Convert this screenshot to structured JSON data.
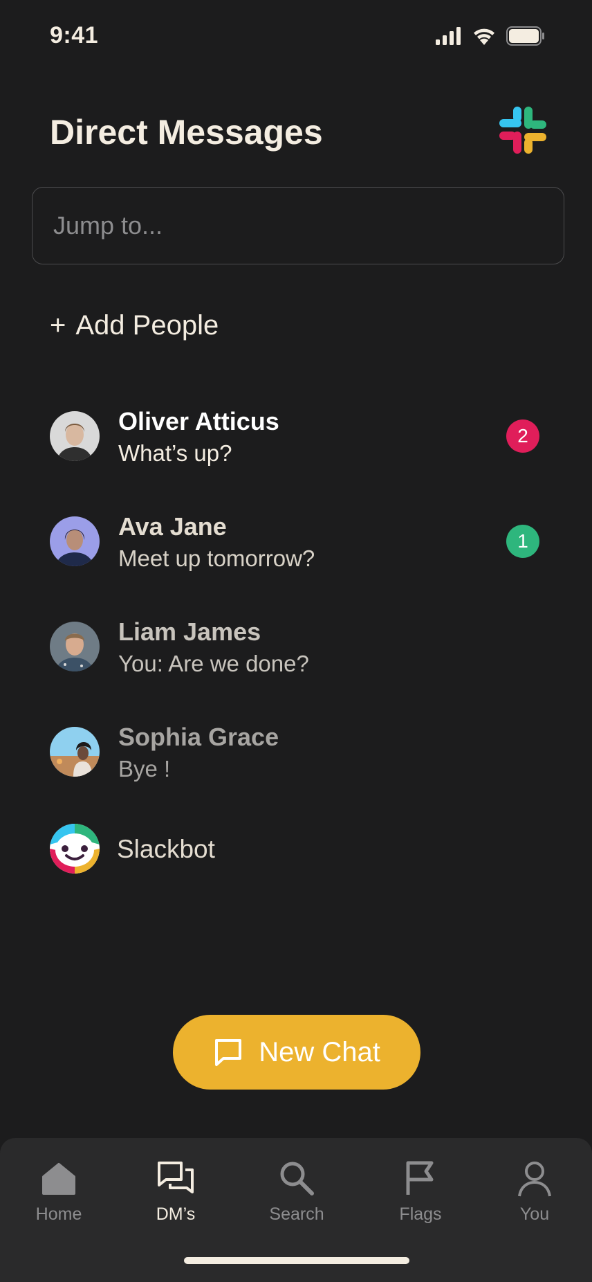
{
  "status_bar": {
    "time": "9:41"
  },
  "header": {
    "title": "Direct Messages",
    "logo": "slack-logo"
  },
  "search": {
    "placeholder": "Jump to..."
  },
  "add_people": {
    "plus": "+",
    "label": "Add People"
  },
  "conversations": [
    {
      "name": "Oliver Atticus",
      "preview": "What’s up?",
      "badge": "2",
      "badge_color": "#e01e5a"
    },
    {
      "name": "Ava Jane",
      "preview": "Meet up tomorrow?",
      "badge": "1",
      "badge_color": "#2eb67d"
    },
    {
      "name": "Liam James",
      "preview": "You: Are we done?"
    },
    {
      "name": "Sophia Grace",
      "preview": "Bye !"
    },
    {
      "name": "Slackbot"
    }
  ],
  "new_chat": {
    "label": "New Chat",
    "icon": "chat-bubble-icon"
  },
  "tab_bar": {
    "tabs": [
      {
        "label": "Home",
        "icon": "home-icon"
      },
      {
        "label": "DM’s",
        "icon": "messages-icon",
        "active": true
      },
      {
        "label": "Search",
        "icon": "search-icon"
      },
      {
        "label": "Flags",
        "icon": "flag-icon"
      },
      {
        "label": "You",
        "icon": "person-icon"
      }
    ]
  },
  "colors": {
    "background": "#1c1c1d",
    "accent": "#ecb22e",
    "text": "#f4ede1",
    "muted": "#8d8d8f"
  }
}
